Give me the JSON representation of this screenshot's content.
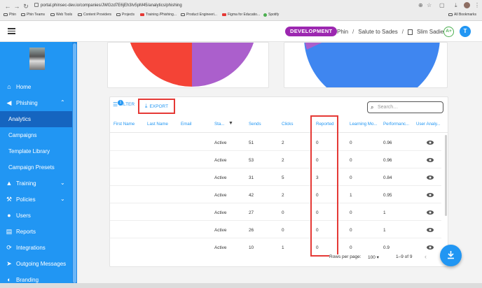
{
  "browser": {
    "url": "portal.phinsec-dev.io/companies/JWGzd7E6jEh3Iv5pM45/analytics/phishing",
    "bookmarks": [
      "Phin",
      "Phin Teams",
      "Web Tools",
      "Content Providers",
      "Projects",
      "Training /Phishing...",
      "Product Engineeri...",
      "Figma for Educatio...",
      "Spotify"
    ],
    "all_bookmarks": "All Bookmarks"
  },
  "header": {
    "env_badge": "DEVELOPMENT",
    "breadcrumb": [
      "Phin",
      "Salute to Sades",
      "Slim Sadie"
    ],
    "avatar_initial": "A+",
    "user_initial": "T",
    "badge_color": "#9c27b0",
    "accent_color": "#2196f3"
  },
  "sidebar": {
    "items": [
      {
        "label": "Home",
        "icon": "home-icon"
      },
      {
        "label": "Phishing",
        "icon": "fish-icon"
      },
      {
        "label": "Analytics"
      },
      {
        "label": "Campaigns"
      },
      {
        "label": "Template Library"
      },
      {
        "label": "Campaign Presets"
      },
      {
        "label": "Training",
        "icon": "graduation-cap-icon"
      },
      {
        "label": "Policies",
        "icon": "gavel-icon"
      },
      {
        "label": "Users",
        "icon": "users-icon"
      },
      {
        "label": "Reports",
        "icon": "chart-icon"
      },
      {
        "label": "Integrations",
        "icon": "sync-icon"
      },
      {
        "label": "Outgoing Messages",
        "icon": "send-icon"
      },
      {
        "label": "Branding",
        "icon": "palette-icon"
      }
    ]
  },
  "table": {
    "filter_label": "FILTER",
    "filter_count": "1",
    "export_label": "EXPORT",
    "search_placeholder": "Search…",
    "columns": [
      "First Name",
      "Last Name",
      "Email",
      "Sta...",
      "Sends",
      "Clicks",
      "Reported",
      "Learning Mo...",
      "Performanc...",
      "User Analy..."
    ],
    "rows": [
      {
        "status": "Active",
        "sends": "51",
        "clicks": "2",
        "reported": "0",
        "learning": "0",
        "performance": "0.96"
      },
      {
        "status": "Active",
        "sends": "53",
        "clicks": "2",
        "reported": "0",
        "learning": "0",
        "performance": "0.96"
      },
      {
        "status": "Active",
        "sends": "31",
        "clicks": "5",
        "reported": "3",
        "learning": "0",
        "performance": "0.84"
      },
      {
        "status": "Active",
        "sends": "42",
        "clicks": "2",
        "reported": "0",
        "learning": "1",
        "performance": "0.95"
      },
      {
        "status": "Active",
        "sends": "27",
        "clicks": "0",
        "reported": "0",
        "learning": "0",
        "performance": "1"
      },
      {
        "status": "Active",
        "sends": "26",
        "clicks": "0",
        "reported": "0",
        "learning": "0",
        "performance": "1"
      },
      {
        "status": "Active",
        "sends": "10",
        "clicks": "1",
        "reported": "0",
        "learning": "0",
        "performance": "0.9"
      }
    ],
    "rows_per_page_label": "Rows per page:",
    "rows_per_page": "100",
    "pagination": "1–9 of 9"
  }
}
